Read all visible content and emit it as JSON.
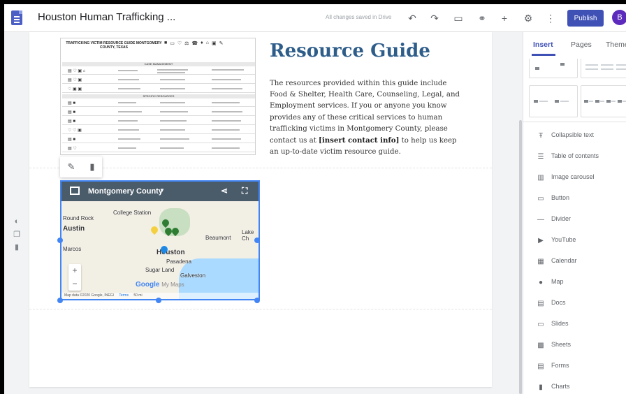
{
  "header": {
    "doc_title": "Houston Human Trafficking ...",
    "save_status": "All changes saved in Drive",
    "publish_label": "Publish",
    "avatar_letter": "B"
  },
  "guide_image": {
    "title": "TRAFFICKING VICTIM RESOURCE GUIDE MONTGOMERY COUNTY, TEXAS",
    "section_1": "CASE MANAGEMENT",
    "section_2": "SPECIFIC RESOURCES"
  },
  "content": {
    "heading": "Resource Guide",
    "body_part1": "The resources provided within this guide include Food & Shelter, Health Care, Counseling, Legal, and Employment services. If you or anyone you know provides any of these critical services to human trafficking victims in Montgomery County, please contact us at ",
    "body_bold": "[insert contact info]",
    "body_part2": " to help us keep an up-to-date victim resource guide."
  },
  "map": {
    "title": "Montgomery County",
    "labels": {
      "round_rock": "Round Rock",
      "college_station": "College Station",
      "austin": "Austin",
      "beaumont": "Beaumont",
      "lake_ch": "Lake Ch",
      "houston": "Houston",
      "pasadena": "Pasadena",
      "sugar_land": "Sugar Land",
      "galveston": "Galveston",
      "marcos": "Marcos"
    },
    "google": "Google",
    "my_maps": "My Maps",
    "footer": "Map data ©2020 Google, INEGI",
    "terms": "Terms",
    "scale": "50 mi"
  },
  "panel": {
    "tabs": [
      "Insert",
      "Pages",
      "Theme"
    ],
    "items": [
      {
        "label": "Collapsible text",
        "icon": "collapsible-text-icon"
      },
      {
        "label": "Table of contents",
        "icon": "table-of-contents-icon"
      },
      {
        "label": "Image carousel",
        "icon": "image-carousel-icon"
      },
      {
        "label": "Button",
        "icon": "button-icon"
      },
      {
        "label": "Divider",
        "icon": "divider-icon"
      },
      {
        "label": "YouTube",
        "icon": "youtube-icon"
      },
      {
        "label": "Calendar",
        "icon": "calendar-icon"
      },
      {
        "label": "Map",
        "icon": "map-icon"
      },
      {
        "label": "Docs",
        "icon": "docs-icon"
      },
      {
        "label": "Slides",
        "icon": "slides-icon"
      },
      {
        "label": "Sheets",
        "icon": "sheets-icon"
      },
      {
        "label": "Forms",
        "icon": "forms-icon"
      },
      {
        "label": "Charts",
        "icon": "charts-icon"
      }
    ]
  },
  "colors": {
    "accent": "#3f51b5",
    "heading": "#2e5d8a",
    "selection": "#4285f4"
  }
}
